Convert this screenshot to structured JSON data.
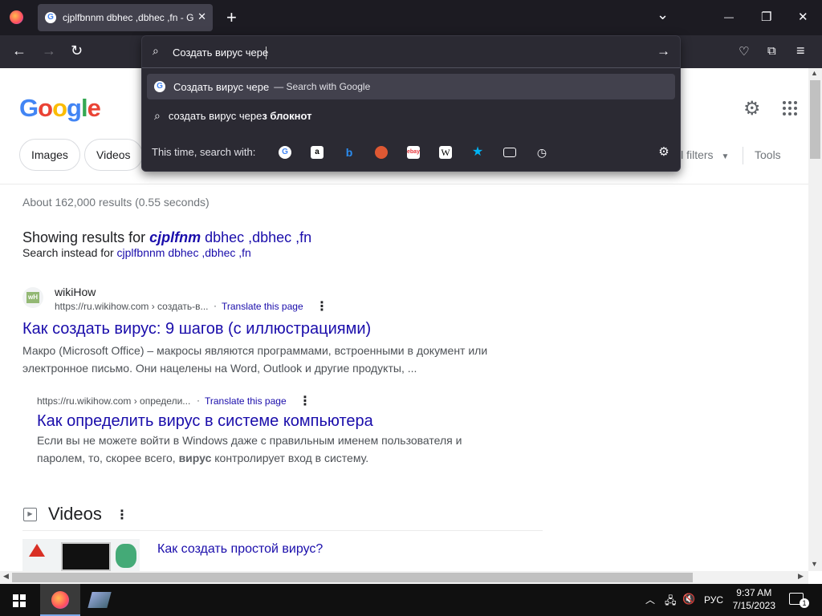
{
  "browser": {
    "tab_title": "cjplfbnnm dbhec ,dbhec ,fn - G",
    "new_tab": "+",
    "window_controls": {
      "list": "⌄",
      "minimize": "—",
      "maximize": "❐",
      "close": "✕"
    }
  },
  "urlbar": {
    "typed": "Создать вирус чере",
    "suggestions": [
      {
        "text": "Создать вирус чере",
        "suffix": "— Search with Google",
        "icon": "google-icon"
      },
      {
        "prefix": "создать вирус чере",
        "bold": "з блокнот",
        "icon": "search-icon"
      }
    ],
    "oneoff_label": "This time, search with:",
    "engines": [
      "google",
      "amazon",
      "bing",
      "duckduckgo",
      "ebay",
      "wikipedia",
      "bookmarks",
      "tabs",
      "history"
    ]
  },
  "google": {
    "chips": [
      "Images",
      "Videos"
    ],
    "all_filters": "ll filters",
    "tools": "Tools",
    "stats": "About 162,000 results (0.55 seconds)",
    "showing_prefix": "Showing results for ",
    "showing_bold": "cjplfnm",
    "showing_rest": " dbhec ,dbhec ,fn",
    "instead_prefix": "Search instead for ",
    "instead_query": "cjplfbnnm dbhec ,dbhec ,fn",
    "results": [
      {
        "site": "wikiHow",
        "cite": "https://ru.wikihow.com › создать-в...",
        "translate": "Translate this page",
        "title": "Как создать вирус: 9 шагов (с иллюстрациями)",
        "snippet1": "Макро (Microsoft Office) – макросы являются программами, встроенными в документ или",
        "snippet2": "электронное письмо. Они нацелены на Word, Outlook и другие продукты, ..."
      },
      {
        "cite": "https://ru.wikihow.com › определи...",
        "translate": "Translate this page",
        "title": "Как определить вирус в системе компьютера",
        "snippet1": "Если вы не можете войти в Windows даже с правильным именем пользователя и",
        "snippet2_pre": "паролем, то, скорее всего, ",
        "snippet2_bold": "вирус",
        "snippet2_post": " контролирует вход в систему."
      }
    ],
    "videos_heading": "Videos",
    "video_title": "Как создать простой вирус?"
  },
  "taskbar": {
    "lang": "РУС",
    "time": "9:37 AM",
    "date": "7/15/2023"
  }
}
